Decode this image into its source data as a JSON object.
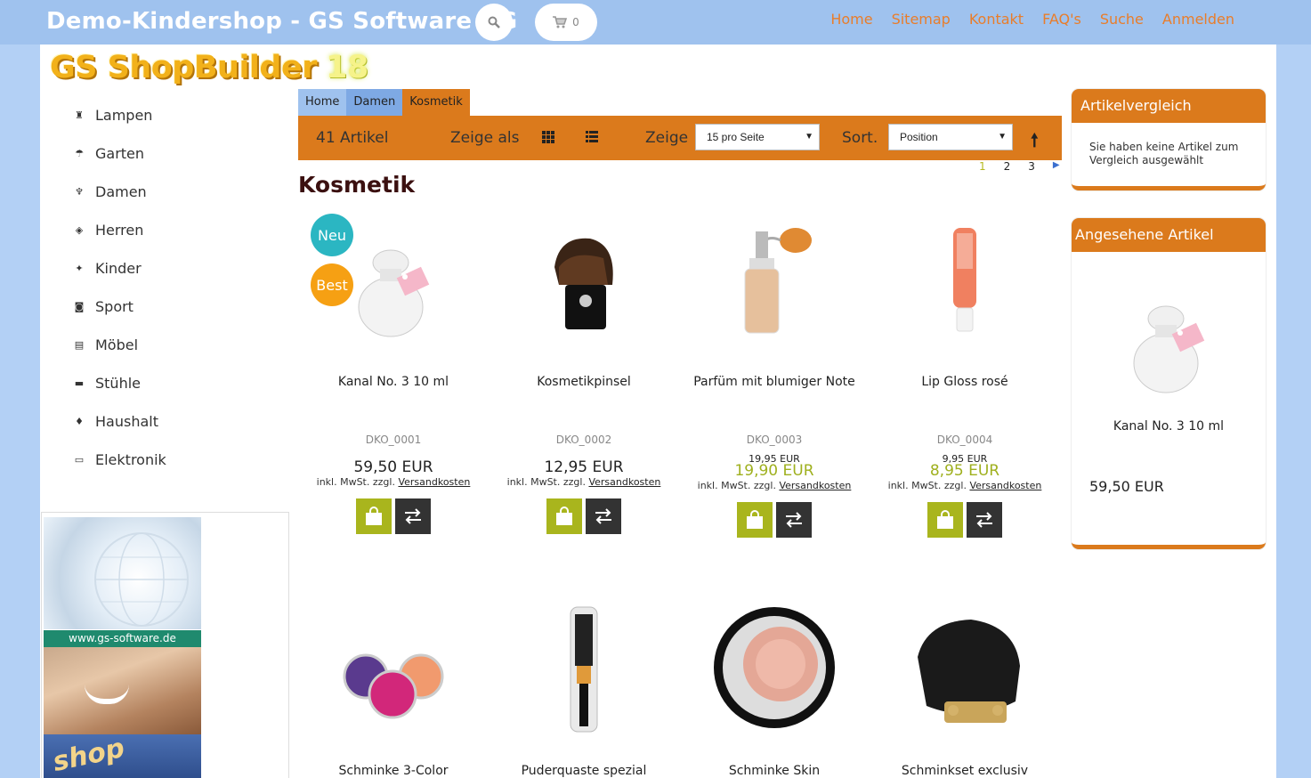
{
  "header": {
    "shop_title": "Demo-Kindershop - GS Software AG",
    "cart_count": "0",
    "nav": [
      "Home",
      "Sitemap",
      "Kontakt",
      "FAQ's",
      "Suche",
      "Anmelden"
    ]
  },
  "logo": {
    "text": "GS ShopBuilder",
    "version": "18"
  },
  "sidebar": {
    "categories": [
      {
        "label": "Lampen",
        "icon": "lamp-icon"
      },
      {
        "label": "Garten",
        "icon": "garden-icon"
      },
      {
        "label": "Damen",
        "icon": "women-icon"
      },
      {
        "label": "Herren",
        "icon": "men-icon"
      },
      {
        "label": "Kinder",
        "icon": "kids-icon"
      },
      {
        "label": "Sport",
        "icon": "sport-icon"
      },
      {
        "label": "Möbel",
        "icon": "furniture-icon"
      },
      {
        "label": "Stühle",
        "icon": "chair-icon"
      },
      {
        "label": "Haushalt",
        "icon": "household-icon"
      },
      {
        "label": "Elektronik",
        "icon": "electronics-icon"
      }
    ],
    "banner": {
      "url": "www.gs-software.de",
      "shop": "shop"
    }
  },
  "breadcrumb": [
    "Home",
    "Damen",
    "Kosmetik"
  ],
  "toolbar": {
    "count": "41 Artikel",
    "show_as": "Zeige als",
    "show": "Zeige",
    "per_page": "15 pro Seite",
    "sort_label": "Sort.",
    "sort_value": "Position"
  },
  "pager": {
    "pages": [
      "1",
      "2",
      "3"
    ],
    "current": "1"
  },
  "category_title": "Kosmetik",
  "badges": {
    "new": "Neu",
    "best": "Best"
  },
  "products": [
    {
      "name": "Kanal No. 3 10 ml",
      "sku": "DKO_0001",
      "old_price": "",
      "price": "59,50 EUR",
      "tax": "inkl. MwSt. zzgl.",
      "shipping": "Versandkosten"
    },
    {
      "name": "Kosmetikpinsel",
      "sku": "DKO_0002",
      "old_price": "",
      "price": "12,95 EUR",
      "tax": "inkl. MwSt. zzgl.",
      "shipping": "Versandkosten"
    },
    {
      "name": "Parfüm mit blumiger Note",
      "sku": "DKO_0003",
      "old_price": "19,95 EUR",
      "price": "19,90 EUR",
      "tax": "inkl. MwSt. zzgl.",
      "shipping": "Versandkosten"
    },
    {
      "name": "Lip Gloss rosé",
      "sku": "DKO_0004",
      "old_price": "9,95 EUR",
      "price": "8,95 EUR",
      "tax": "inkl. MwSt. zzgl.",
      "shipping": "Versandkosten"
    },
    {
      "name": "Schminke 3-Color"
    },
    {
      "name": "Puderquaste spezial"
    },
    {
      "name": "Schminke Skin"
    },
    {
      "name": "Schminkset exclusiv"
    }
  ],
  "compare_box": {
    "title": "Artikelvergleich",
    "text": "Sie haben keine Artikel zum Vergleich ausgewählt"
  },
  "viewed_box": {
    "title": "Angesehene Artikel",
    "name": "Kanal No. 3 10 ml",
    "price": "59,50 EUR"
  },
  "colors": {
    "orange": "#db7a1c",
    "topbar": "#9fc2ee",
    "sale_green": "#9fb01e",
    "cart_green": "#a9b51d"
  }
}
